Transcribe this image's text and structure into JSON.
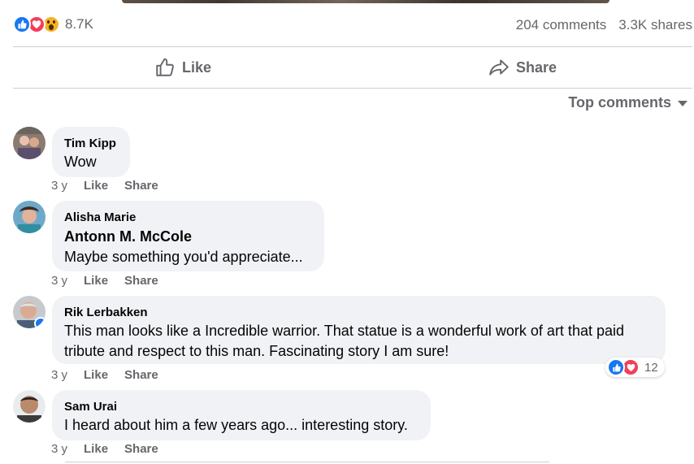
{
  "post": {
    "reaction_count": "8.7K",
    "comments_count": "204 comments",
    "shares_count": "3.3K shares",
    "reaction_icons": [
      "like-icon",
      "love-icon",
      "wow-icon"
    ]
  },
  "actions": {
    "like_label": "Like",
    "share_label": "Share"
  },
  "sort": {
    "label": "Top comments"
  },
  "colors": {
    "like": "#1877f2",
    "love": "#f33e58",
    "wow": "#f7b125",
    "bubble": "#f0f2f5",
    "secondary_text": "#65676b"
  },
  "comments": [
    {
      "author": "Tim Kipp",
      "text": "Wow",
      "time": "3 y",
      "like": "Like",
      "share": "Share"
    },
    {
      "author": "Alisha Marie",
      "mention": "Antonn M. McCole",
      "text": "Maybe something you'd appreciate...",
      "time": "3 y",
      "like": "Like",
      "share": "Share"
    },
    {
      "author": "Rik Lerbakken",
      "text_line1": "This man looks like a Incredible warrior. That statue is a wonderful work of art that paid",
      "text_line2": "tribute and respect to this man. Fascinating story I am sure!",
      "time": "3 y",
      "like": "Like",
      "share": "Share",
      "reaction_count": "12"
    },
    {
      "author": "Sam Urai",
      "text": "I heard about him a few years ago... interesting story.",
      "time": "3 y",
      "like": "Like",
      "share": "Share"
    }
  ]
}
